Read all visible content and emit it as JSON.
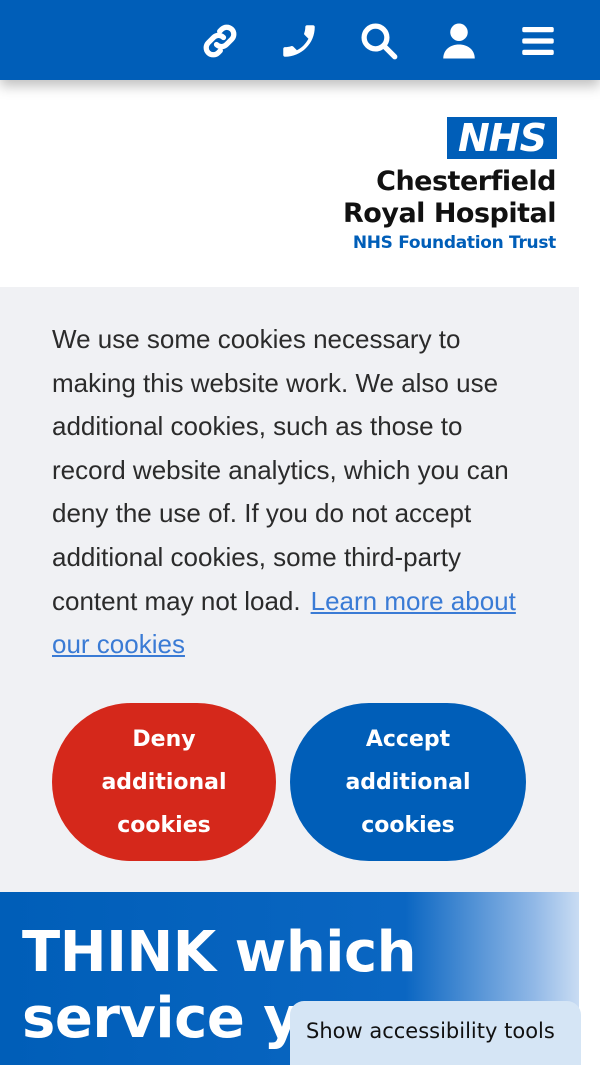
{
  "topbar": {
    "icons": [
      "link-icon",
      "phone-icon",
      "search-icon",
      "account-icon",
      "menu-icon"
    ],
    "background": "#005eb8"
  },
  "logo": {
    "badge": "NHS",
    "line1": "Chesterfield",
    "line2": "Royal Hospital",
    "line3": "NHS Foundation Trust"
  },
  "cookie_banner": {
    "text": "We use some cookies necessary to making this website work. We also use additional cookies, such as those to record website analytics, which you can deny the use of. If you do not accept additional cookies, some third-party content may not load.",
    "link": "Learn more about our cookies",
    "deny_label": "Deny additional cookies",
    "accept_label": "Accept additional cookies",
    "deny_color": "#d5281b",
    "accept_color": "#005eb8"
  },
  "hero": {
    "title": "THINK which service yo"
  },
  "accessibility_tab": {
    "label": "Show accessibility tools"
  }
}
